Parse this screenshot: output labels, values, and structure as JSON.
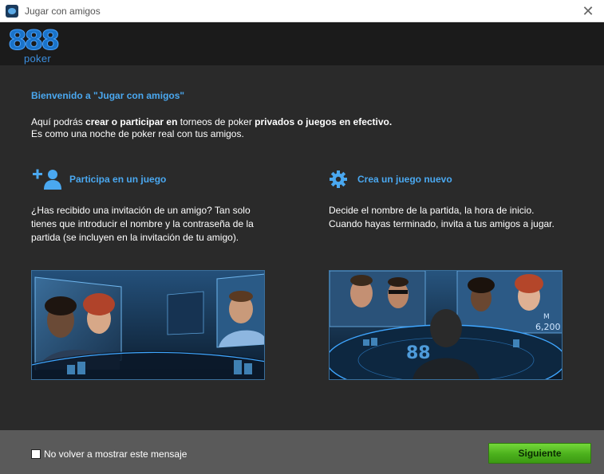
{
  "window": {
    "title": "Jugar con amigos",
    "close_glyph": "✕"
  },
  "logo": {
    "brand": "888",
    "product": "poker"
  },
  "main": {
    "welcome": "Bienvenido a \"Jugar con amigos\"",
    "intro": {
      "p1": "Aquí podrás ",
      "b1": "crear o participar en",
      "p2": " torneos de poker ",
      "b2": "privados o juegos en efectivo.",
      "line2": "Es como una noche de poker real con tus amigos."
    },
    "join": {
      "icon": "add-user-icon",
      "title": "Participa en un juego",
      "desc": "¿Has recibido una invitación de un amigo? Tan solo tienes que introducir el nombre y la contraseña de la partida (se incluyen en la invitación de tu amigo)."
    },
    "create": {
      "icon": "gear-icon",
      "title": "Crea un juego nuevo",
      "desc": "Decide el nombre de la partida, la hora de inicio. Cuando hayas terminado, invita a tus amigos a jugar."
    },
    "photo_right_text": {
      "table_logo": "88",
      "screen_letter": "M",
      "screen_value": "6,200"
    }
  },
  "footer": {
    "checkbox_label": "No volver a mostrar este mensaje",
    "next_label": "Siguiente"
  },
  "colors": {
    "accent_blue": "#4aa8f0",
    "button_green": "#4bb01c",
    "header_bg": "#1b1b1b",
    "main_bg": "#2a2a2a",
    "footer_bg": "#5a5a5a"
  }
}
